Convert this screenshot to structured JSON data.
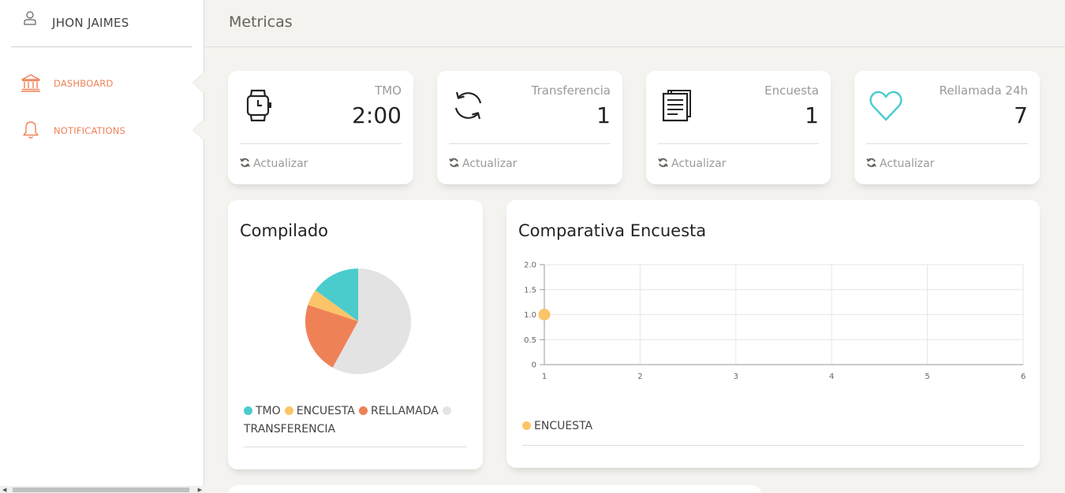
{
  "sidebar": {
    "user_name": "JHON JAIMES",
    "items": [
      {
        "label": "DASHBOARD",
        "icon": "bank-icon"
      },
      {
        "label": "NOTIFICATIONS",
        "icon": "bell-icon"
      }
    ]
  },
  "header": {
    "title": "Metricas"
  },
  "stats": [
    {
      "label": "TMO",
      "value": "2:00",
      "footer": "Actualizar",
      "icon": "watch-icon"
    },
    {
      "label": "Transferencia",
      "value": "1",
      "footer": "Actualizar",
      "icon": "refresh-icon"
    },
    {
      "label": "Encuesta",
      "value": "1",
      "footer": "Actualizar",
      "icon": "papers-icon"
    },
    {
      "label": "Rellamada 24h",
      "value": "7",
      "footer": "Actualizar",
      "icon": "heart-icon"
    }
  ],
  "colors": {
    "accent": "#ef8157",
    "tmo": "#4acccd",
    "encuesta": "#fcc468",
    "rellamada": "#ef8157",
    "transferencia": "#e3e3e3",
    "heart": "#4acccd"
  },
  "compilado": {
    "title": "Compilado"
  },
  "comparativa": {
    "title": "Comparativa Encuesta"
  },
  "chart_data": [
    {
      "type": "pie",
      "title": "Compilado",
      "categories": [
        "TMO",
        "ENCUESTA",
        "RELLAMADA",
        "TRANSFERENCIA"
      ],
      "values": [
        15,
        5,
        22,
        58
      ],
      "colors": [
        "#4acccd",
        "#fcc468",
        "#ef8157",
        "#e3e3e3"
      ],
      "legend_placement": "bottom"
    },
    {
      "type": "line",
      "title": "Comparativa Encuesta",
      "x_ticks": [
        "1",
        "2",
        "3",
        "4",
        "5",
        "6"
      ],
      "y_ticks": [
        "0",
        "0.5",
        "1.0",
        "1.5",
        "2.0"
      ],
      "series": [
        {
          "name": "ENCUESTA",
          "x": [
            1
          ],
          "y": [
            1.0
          ],
          "color": "#fcc468"
        }
      ],
      "xlim": [
        1,
        6
      ],
      "ylim": [
        0,
        2.0
      ],
      "grid": true,
      "legend_placement": "bottom-left"
    }
  ]
}
